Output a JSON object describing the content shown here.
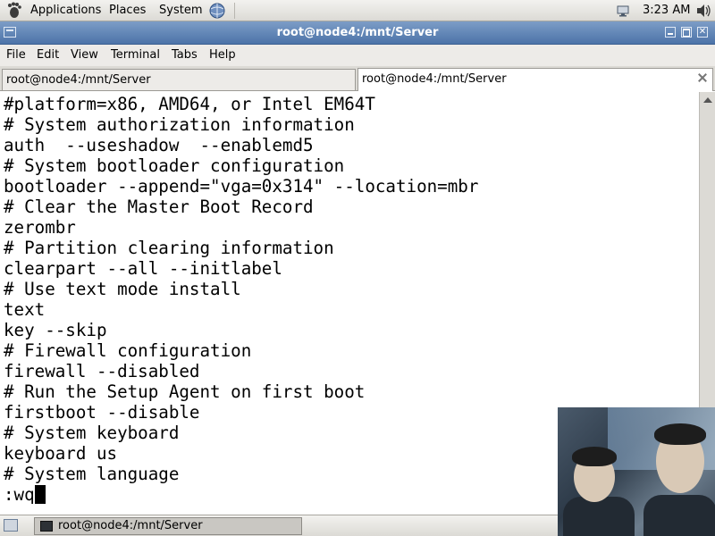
{
  "top_panel": {
    "menus": [
      "Applications",
      "Places",
      "System"
    ],
    "clock": "3:23 AM"
  },
  "window": {
    "title": "root@node4:/mnt/Server"
  },
  "menubar": {
    "items": [
      {
        "label": "File"
      },
      {
        "label": "Edit"
      },
      {
        "label": "View"
      },
      {
        "label": "Terminal"
      },
      {
        "label": "Tabs"
      },
      {
        "label": "Help"
      }
    ]
  },
  "tabs": [
    {
      "label": "root@node4:/mnt/Server"
    },
    {
      "label": "root@node4:/mnt/Server"
    }
  ],
  "terminal": {
    "lines": [
      "#platform=x86, AMD64, or Intel EM64T",
      "# System authorization information",
      "auth  --useshadow  --enablemd5",
      "# System bootloader configuration",
      "bootloader --append=\"vga=0x314\" --location=mbr",
      "# Clear the Master Boot Record",
      "zerombr",
      "# Partition clearing information",
      "clearpart --all --initlabel",
      "# Use text mode install",
      "text",
      "key --skip",
      "# Firewall configuration",
      "firewall --disabled",
      "# Run the Setup Agent on first boot",
      "firstboot --disable",
      "# System keyboard",
      "keyboard us",
      "# System language"
    ],
    "command_line": ":wq"
  },
  "taskbar": {
    "window_button": "root@node4:/mnt/Server"
  },
  "colors": {
    "titlebar": "#4c73a8",
    "terminal_bg": "#ffffff",
    "terminal_fg": "#000000",
    "panel": "#dcdad5"
  },
  "icons": {
    "panel_logo": "gnome-foot-icon",
    "network": "network-icon",
    "volume": "volume-icon",
    "show_desktop": "show-desktop-icon"
  }
}
